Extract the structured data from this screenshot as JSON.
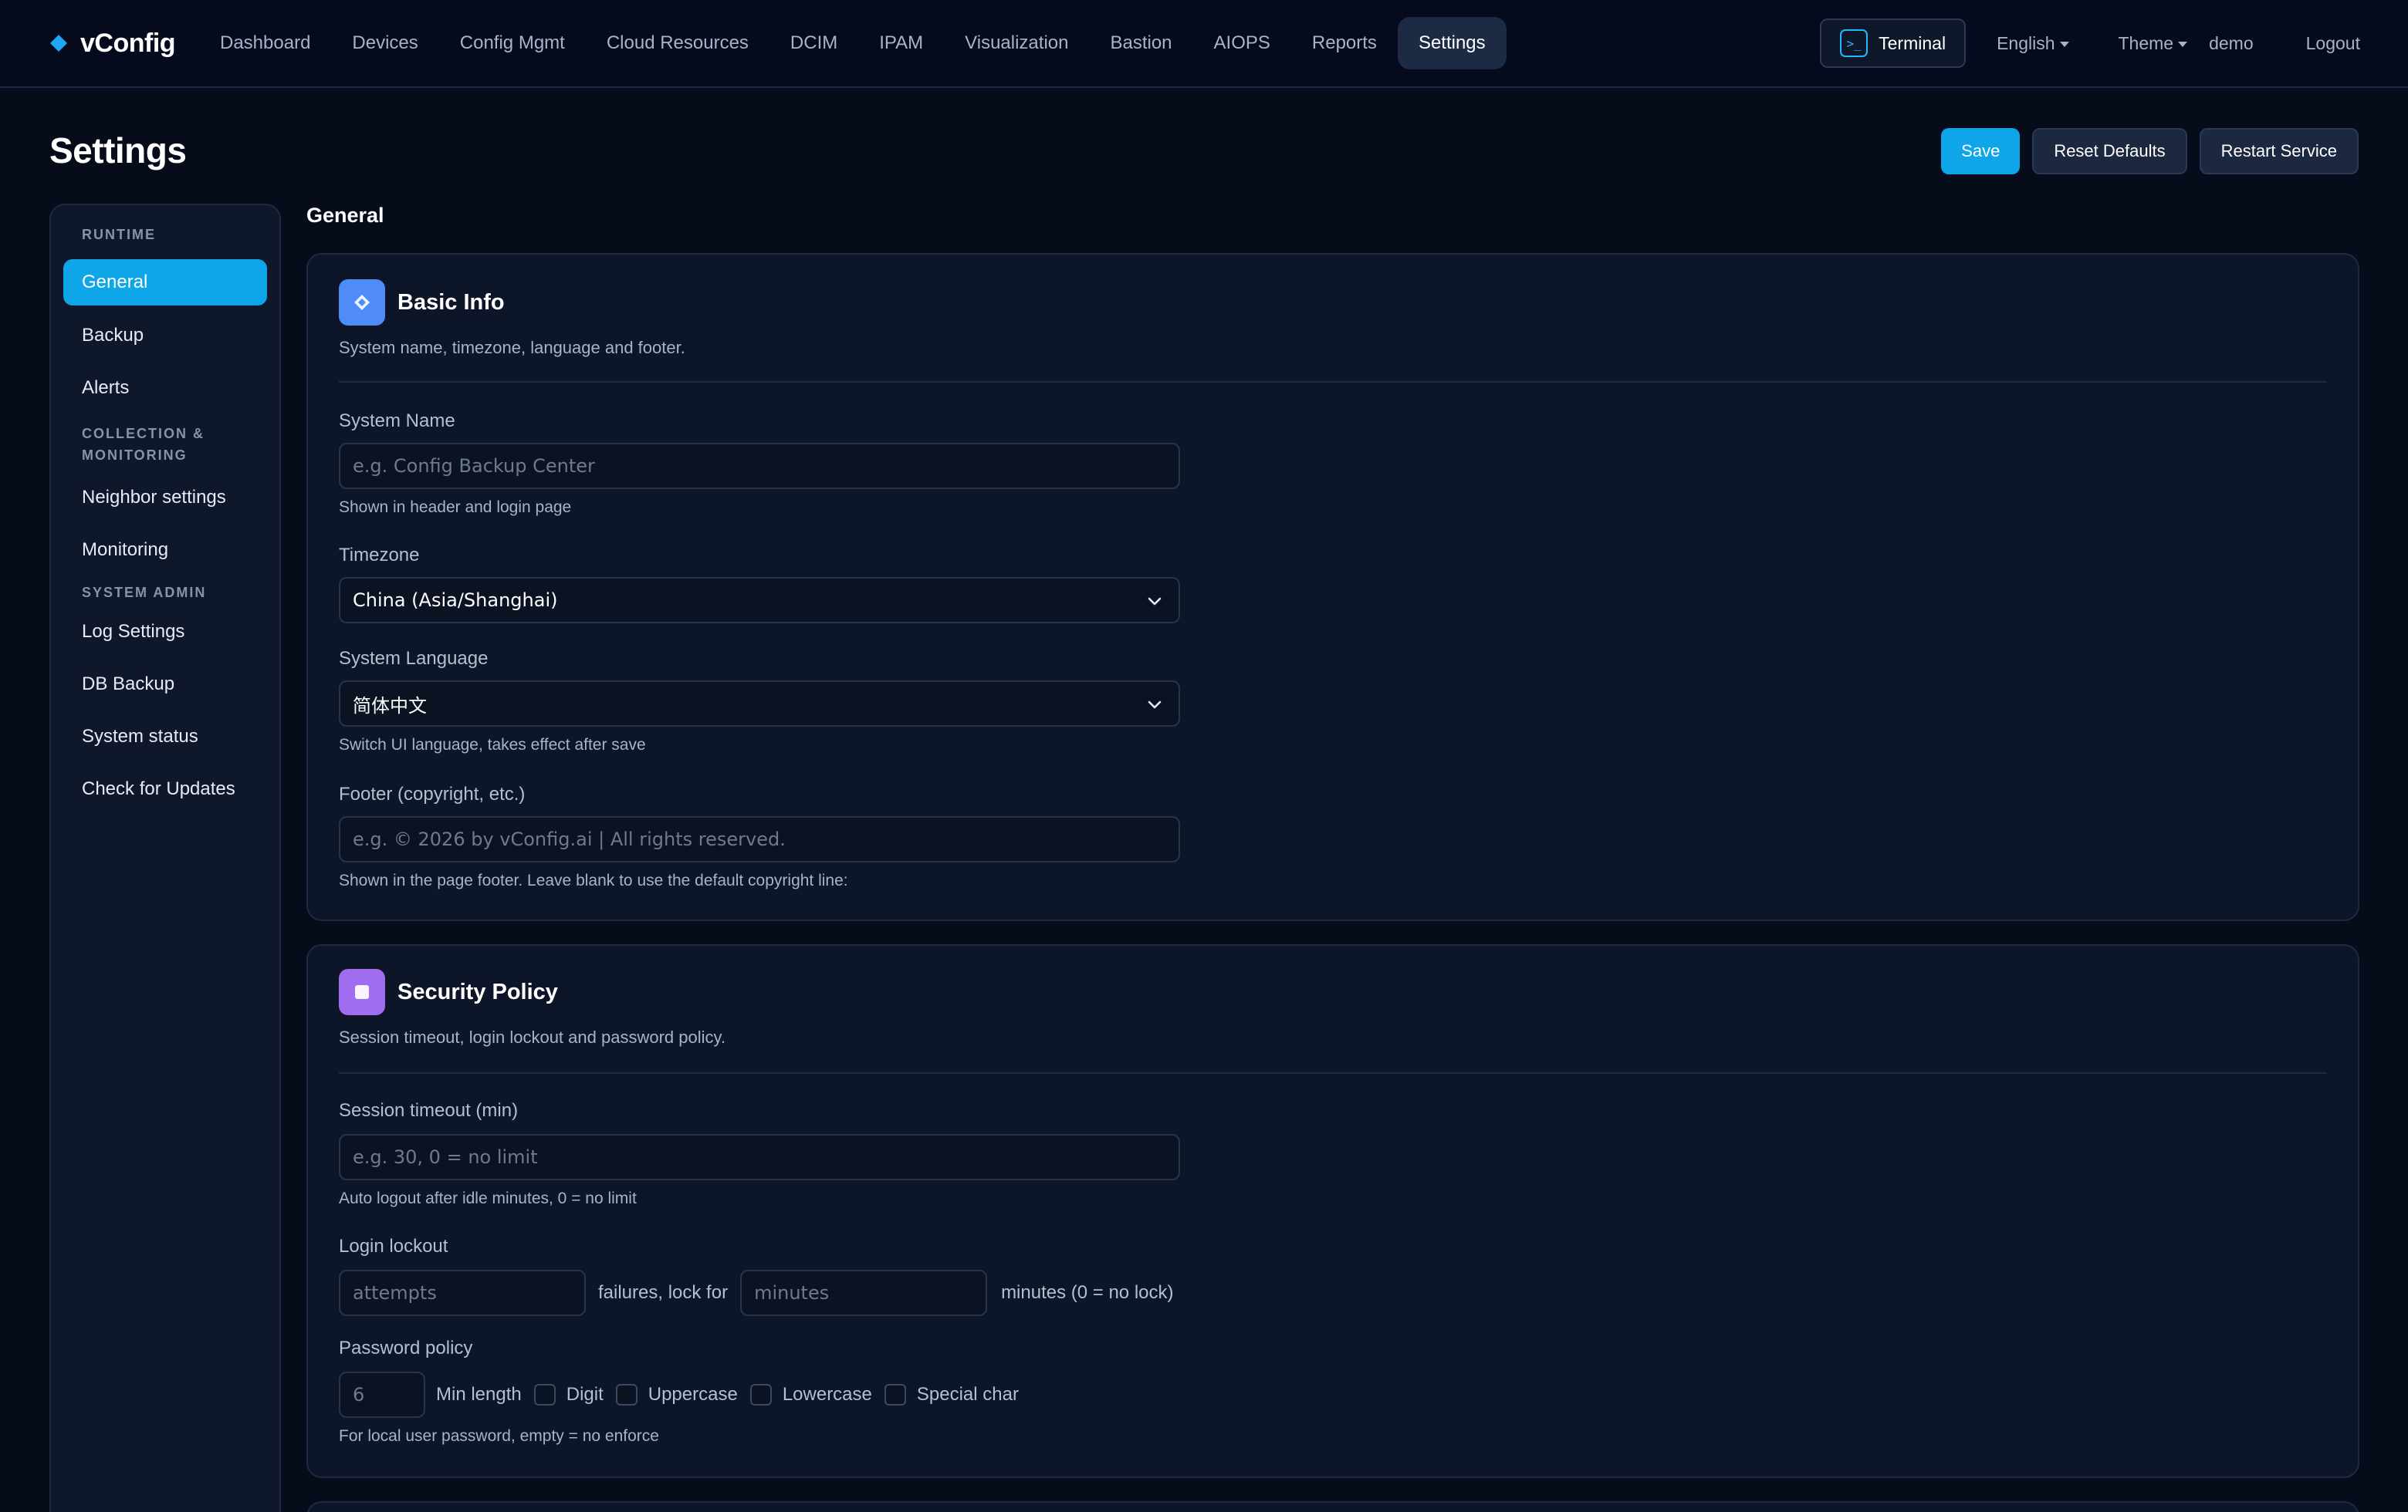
{
  "brand": {
    "name": "vConfig",
    "icon": "diamond-icon"
  },
  "nav": {
    "items": [
      {
        "label": "Dashboard"
      },
      {
        "label": "Devices"
      },
      {
        "label": "Config Mgmt"
      },
      {
        "label": "Cloud Resources"
      },
      {
        "label": "DCIM"
      },
      {
        "label": "IPAM"
      },
      {
        "label": "Visualization"
      },
      {
        "label": "Bastion"
      },
      {
        "label": "AIOPS"
      },
      {
        "label": "Reports"
      },
      {
        "label": "Settings",
        "active": true
      }
    ],
    "terminal_label": "Terminal",
    "terminal_icon_glyph": ">_",
    "language": "English",
    "theme": "Theme",
    "user": "demo",
    "logout": "Logout"
  },
  "page": {
    "title": "Settings",
    "actions": {
      "save": "Save",
      "reset": "Reset Defaults",
      "restart": "Restart Service"
    },
    "section_heading": "General"
  },
  "sidebar": {
    "sections": [
      {
        "title": "RUNTIME",
        "items": [
          "General",
          "Backup",
          "Alerts"
        ]
      },
      {
        "title": "COLLECTION & MONITORING",
        "items": [
          "Neighbor settings",
          "Monitoring"
        ]
      },
      {
        "title": "SYSTEM ADMIN",
        "items": [
          "Log Settings",
          "DB Backup",
          "System status",
          "Check for Updates"
        ]
      }
    ],
    "active_item": "General"
  },
  "basic_info": {
    "title": "Basic Info",
    "description": "System name, timezone, language and footer.",
    "system_name": {
      "label": "System Name",
      "placeholder": "e.g. Config Backup Center",
      "hint": "Shown in header and login page"
    },
    "timezone": {
      "label": "Timezone",
      "value": "China (Asia/Shanghai)"
    },
    "language": {
      "label": "System Language",
      "value": "简体中文",
      "hint": "Switch UI language, takes effect after save"
    },
    "footer": {
      "label": "Footer (copyright, etc.)",
      "placeholder": "e.g. © 2026 by vConfig.ai | All rights reserved.",
      "hint": "Shown in the page footer. Leave blank to use the default copyright line:"
    }
  },
  "security_policy": {
    "title": "Security Policy",
    "description": "Session timeout, login lockout and password policy.",
    "session_timeout": {
      "label": "Session timeout (min)",
      "placeholder": "e.g. 30, 0 = no limit",
      "hint": "Auto logout after idle minutes, 0 = no limit"
    },
    "login_lockout": {
      "label": "Login lockout",
      "attempts_placeholder": "attempts",
      "middle_text": "failures, lock for",
      "minutes_placeholder": "minutes",
      "suffix": "minutes (0 = no lock)"
    },
    "password_policy": {
      "label": "Password policy",
      "min_length_placeholder": "6",
      "min_length_label": "Min length",
      "options": [
        "Digit",
        "Uppercase",
        "Lowercase",
        "Special char"
      ],
      "hint": "For local user password, empty = no enforce"
    }
  },
  "colors": {
    "accent": "#0ea5e9",
    "background": "#070c1a",
    "card": "#0d1628",
    "basic_icon": "#4f8cf7",
    "security_icon": "#a06cf0"
  }
}
